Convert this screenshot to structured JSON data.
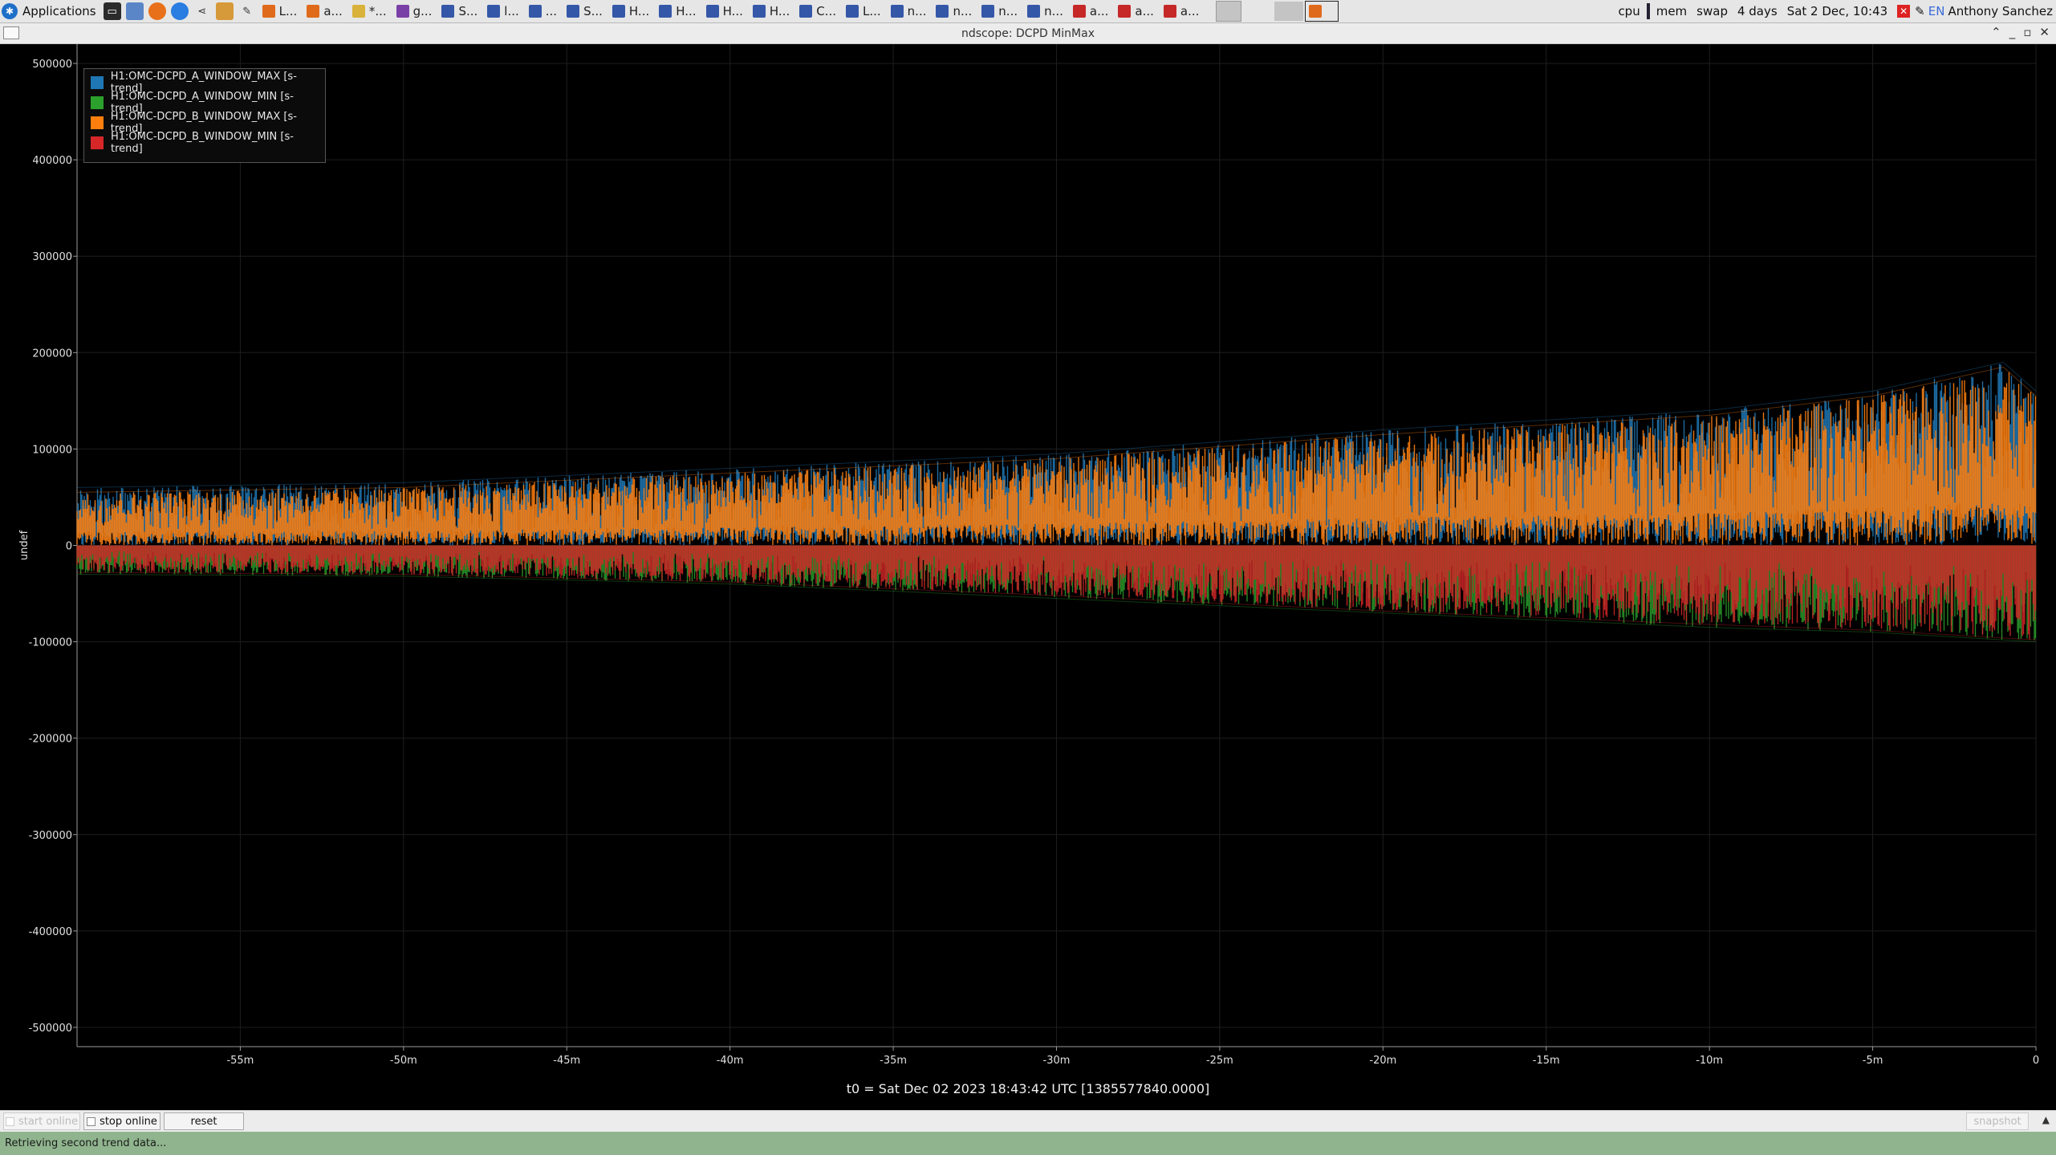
{
  "taskbar": {
    "app_menu_label": "Applications",
    "launchers": [
      "terminal-icon",
      "folder-icon",
      "firefox-icon",
      "chrome-icon",
      "share-icon",
      "people-icon",
      "editor-icon"
    ],
    "tasks": [
      {
        "label": "L...",
        "icon": "firefox-icon",
        "color": "#e06a1b"
      },
      {
        "label": "a...",
        "icon": "firefox-icon",
        "color": "#e06a1b"
      },
      {
        "label": "*...",
        "icon": "notes-icon",
        "color": "#d8b23a"
      },
      {
        "label": "g...",
        "icon": "x-icon",
        "color": "#7a3fa6"
      },
      {
        "label": "S...",
        "icon": "monitor-icon",
        "color": "#3557a8"
      },
      {
        "label": "l...",
        "icon": "monitor-icon",
        "color": "#3557a8"
      },
      {
        "label": "...",
        "icon": "window-icon",
        "color": "#3557a8"
      },
      {
        "label": "S...",
        "icon": "monitor-icon",
        "color": "#3557a8"
      },
      {
        "label": "H...",
        "icon": "monitor-icon",
        "color": "#3557a8"
      },
      {
        "label": "H...",
        "icon": "monitor-icon",
        "color": "#3557a8"
      },
      {
        "label": "H...",
        "icon": "monitor-icon",
        "color": "#3557a8"
      },
      {
        "label": "H...",
        "icon": "monitor-icon",
        "color": "#3557a8"
      },
      {
        "label": "C...",
        "icon": "monitor-icon",
        "color": "#3557a8"
      },
      {
        "label": "L...",
        "icon": "monitor-icon",
        "color": "#3557a8"
      },
      {
        "label": "n...",
        "icon": "window-icon",
        "color": "#3557a8"
      },
      {
        "label": "n...",
        "icon": "window-icon",
        "color": "#3557a8"
      },
      {
        "label": "n...",
        "icon": "window-icon",
        "color": "#3557a8"
      },
      {
        "label": "n...",
        "icon": "window-icon",
        "color": "#3557a8"
      },
      {
        "label": "a...",
        "icon": "app-red-icon",
        "color": "#c62828"
      },
      {
        "label": "a...",
        "icon": "app-red-icon",
        "color": "#c62828"
      },
      {
        "label": "a...",
        "icon": "app-red-icon",
        "color": "#c62828"
      }
    ],
    "monitors": [
      "cpu",
      "mem",
      "swap"
    ],
    "uptime": "4 days",
    "clock": "Sat  2 Dec, 10:43",
    "lang": "EN",
    "user": "Anthony Sanchez"
  },
  "window": {
    "title": "ndscope: DCPD MinMax"
  },
  "chart_data": {
    "type": "line",
    "title": "",
    "ylabel": "undef",
    "xlabel": "",
    "ylim": [
      -520000,
      520000
    ],
    "xlim": [
      -60,
      0
    ],
    "x_unit": "minutes",
    "grid": true,
    "legend_position": "top-left",
    "y_ticks": [
      "500000",
      "400000",
      "300000",
      "200000",
      "100000",
      "0",
      "-100000",
      "-200000",
      "-300000",
      "-400000",
      "-500000"
    ],
    "y_tick_values": [
      500000,
      400000,
      300000,
      200000,
      100000,
      0,
      -100000,
      -200000,
      -300000,
      -400000,
      -500000
    ],
    "x_ticks": [
      "-55m",
      "-50m",
      "-45m",
      "-40m",
      "-35m",
      "-30m",
      "-25m",
      "-20m",
      "-15m",
      "-10m",
      "-5m",
      "0"
    ],
    "x_tick_values": [
      -55,
      -50,
      -45,
      -40,
      -35,
      -30,
      -25,
      -20,
      -15,
      -10,
      -5,
      0
    ],
    "series": [
      {
        "name": "H1:OMC-DCPD_A_WINDOW_MAX [s-trend]",
        "color": "#1f77b4",
        "x": [
          -60,
          -50,
          -40,
          -30,
          -20,
          -10,
          -5,
          -1,
          0
        ],
        "values": [
          60000,
          65000,
          80000,
          95000,
          120000,
          140000,
          160000,
          190000,
          160000
        ]
      },
      {
        "name": "H1:OMC-DCPD_A_WINDOW_MIN [s-trend]",
        "color": "#2ca02c",
        "x": [
          -60,
          -50,
          -40,
          -30,
          -20,
          -10,
          -5,
          0
        ],
        "values": [
          -30000,
          -32000,
          -40000,
          -55000,
          -70000,
          -85000,
          -90000,
          -100000
        ]
      },
      {
        "name": "H1:OMC-DCPD_B_WINDOW_MAX [s-trend]",
        "color": "#ff7f0e",
        "x": [
          -60,
          -50,
          -40,
          -30,
          -20,
          -10,
          -5,
          -1,
          0
        ],
        "values": [
          55000,
          60000,
          75000,
          90000,
          115000,
          135000,
          155000,
          185000,
          155000
        ]
      },
      {
        "name": "H1:OMC-DCPD_B_WINDOW_MIN [s-trend]",
        "color": "#d62728",
        "x": [
          -60,
          -50,
          -40,
          -30,
          -20,
          -10,
          -5,
          0
        ],
        "values": [
          -28000,
          -30000,
          -38000,
          -52000,
          -68000,
          -82000,
          -88000,
          -98000
        ]
      }
    ]
  },
  "t0_label": "t0 = Sat Dec 02 2023 18:43:42 UTC [1385577840.0000]",
  "toolbar": {
    "start_online": "start online",
    "stop_online": "stop online",
    "reset": "reset",
    "snapshot": "snapshot"
  },
  "status": "Retrieving second trend data..."
}
